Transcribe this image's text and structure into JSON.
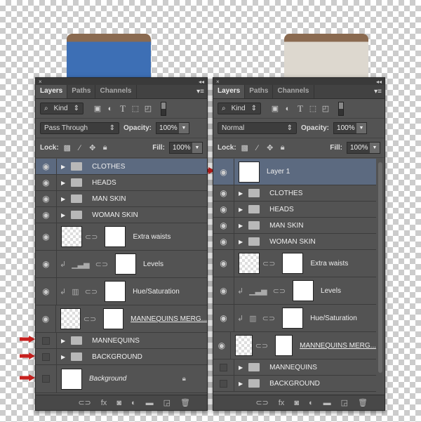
{
  "panels": [
    {
      "id": "left",
      "title_close": "×",
      "title_collapse": "◂◂",
      "tabs": [
        "Layers",
        "Paths",
        "Channels"
      ],
      "kind": "Kind",
      "blend": "Pass Through",
      "opacity_label": "Opacity:",
      "opacity": "100%",
      "lock_label": "Lock:",
      "fill_label": "Fill:",
      "fill": "100%",
      "layers": [
        {
          "type": "group",
          "name": "CLOTHES",
          "visible": true,
          "selected": true
        },
        {
          "type": "group",
          "name": "HEADS",
          "visible": true
        },
        {
          "type": "group",
          "name": "MAN SKIN",
          "visible": true
        },
        {
          "type": "group",
          "name": "WOMAN SKIN",
          "visible": true
        },
        {
          "type": "masked",
          "name": "Extra waists",
          "visible": true,
          "checker": true
        },
        {
          "type": "adjust",
          "name": "Levels",
          "visible": true,
          "adj": "levels"
        },
        {
          "type": "adjust",
          "name": "Hue/Saturation",
          "visible": true,
          "adj": "hue"
        },
        {
          "type": "masked",
          "name": "MANNEQUINS MERG...",
          "visible": true,
          "checker": true,
          "underline": true
        },
        {
          "type": "group",
          "name": "MANNEQUINS",
          "visible": false
        },
        {
          "type": "group",
          "name": "BACKGROUND",
          "visible": false
        },
        {
          "type": "bg",
          "name": "Background",
          "visible": false
        }
      ]
    },
    {
      "id": "right",
      "title_close": "×",
      "title_collapse": "◂◂",
      "tabs": [
        "Layers",
        "Paths",
        "Channels"
      ],
      "kind": "Kind",
      "blend": "Normal",
      "opacity_label": "Opacity:",
      "opacity": "100%",
      "lock_label": "Lock:",
      "fill_label": "Fill:",
      "fill": "100%",
      "layers": [
        {
          "type": "single",
          "name": "Layer 1",
          "visible": true,
          "selected": true
        },
        {
          "type": "group",
          "name": "CLOTHES",
          "visible": true
        },
        {
          "type": "group",
          "name": "HEADS",
          "visible": true
        },
        {
          "type": "group",
          "name": "MAN SKIN",
          "visible": true
        },
        {
          "type": "group",
          "name": "WOMAN SKIN",
          "visible": true
        },
        {
          "type": "masked",
          "name": "Extra waists",
          "visible": true,
          "checker": true
        },
        {
          "type": "adjust",
          "name": "Levels",
          "visible": true,
          "adj": "levels"
        },
        {
          "type": "adjust",
          "name": "Hue/Saturation",
          "visible": true,
          "adj": "hue"
        },
        {
          "type": "masked",
          "name": "MANNEQUINS MERG...",
          "visible": true,
          "checker": true,
          "underline": true
        },
        {
          "type": "group",
          "name": "MANNEQUINS",
          "visible": false
        },
        {
          "type": "group",
          "name": "BACKGROUND",
          "visible": false
        }
      ]
    }
  ],
  "footer_icons": [
    "link-icon",
    "fx-icon",
    "mask-icon",
    "adjustment-icon",
    "new-group-icon",
    "new-layer-icon",
    "trash-icon"
  ],
  "colors": {
    "arrow": "#c8201e",
    "selected": "#5c6a80"
  }
}
